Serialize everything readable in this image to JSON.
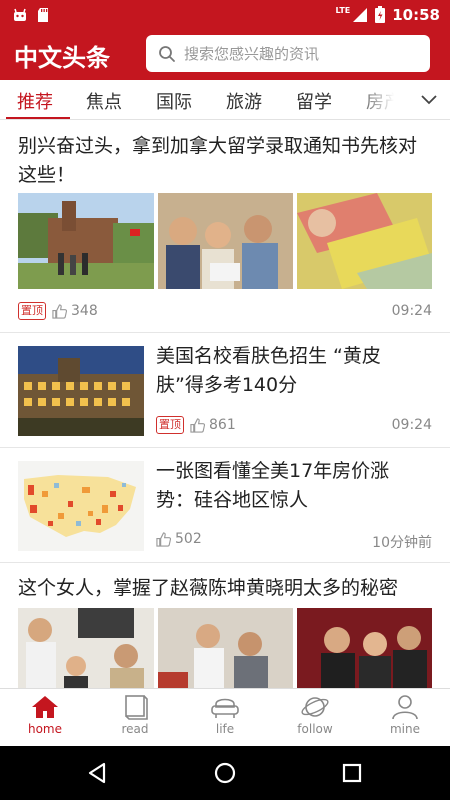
{
  "status_bar": {
    "network": "LTE",
    "time": "10:58"
  },
  "app": {
    "logo": "中文头条"
  },
  "search": {
    "placeholder": "搜索您感兴趣的资讯"
  },
  "tabs": [
    "推荐",
    "焦点",
    "国际",
    "旅游",
    "留学",
    "房产"
  ],
  "articles": [
    {
      "title": "别兴奋过头，拿到加拿大留学录取通知书先核对这些！",
      "badge": "置顶",
      "likes": "348",
      "time": "09:24"
    },
    {
      "title": "美国名校看肤色招生 “黄皮肤”得多考140分",
      "badge": "置顶",
      "likes": "861",
      "time": "09:24"
    },
    {
      "title": "一张图看懂全美17年房价涨势：硅谷地区惊人",
      "badge": "",
      "likes": "502",
      "time": "10分钟前"
    },
    {
      "title": "这个女人，掌握了赵薇陈坤黄晓明太多的秘密"
    }
  ],
  "bottom_nav": [
    {
      "label": "home",
      "icon": "home-icon",
      "active": true
    },
    {
      "label": "read",
      "icon": "book-icon",
      "active": false
    },
    {
      "label": "life",
      "icon": "sofa-icon",
      "active": false
    },
    {
      "label": "follow",
      "icon": "planet-icon",
      "active": false
    },
    {
      "label": "mine",
      "icon": "person-icon",
      "active": false
    }
  ],
  "colors": {
    "brand": "#c4161f",
    "text": "#222222",
    "muted": "#888888"
  }
}
